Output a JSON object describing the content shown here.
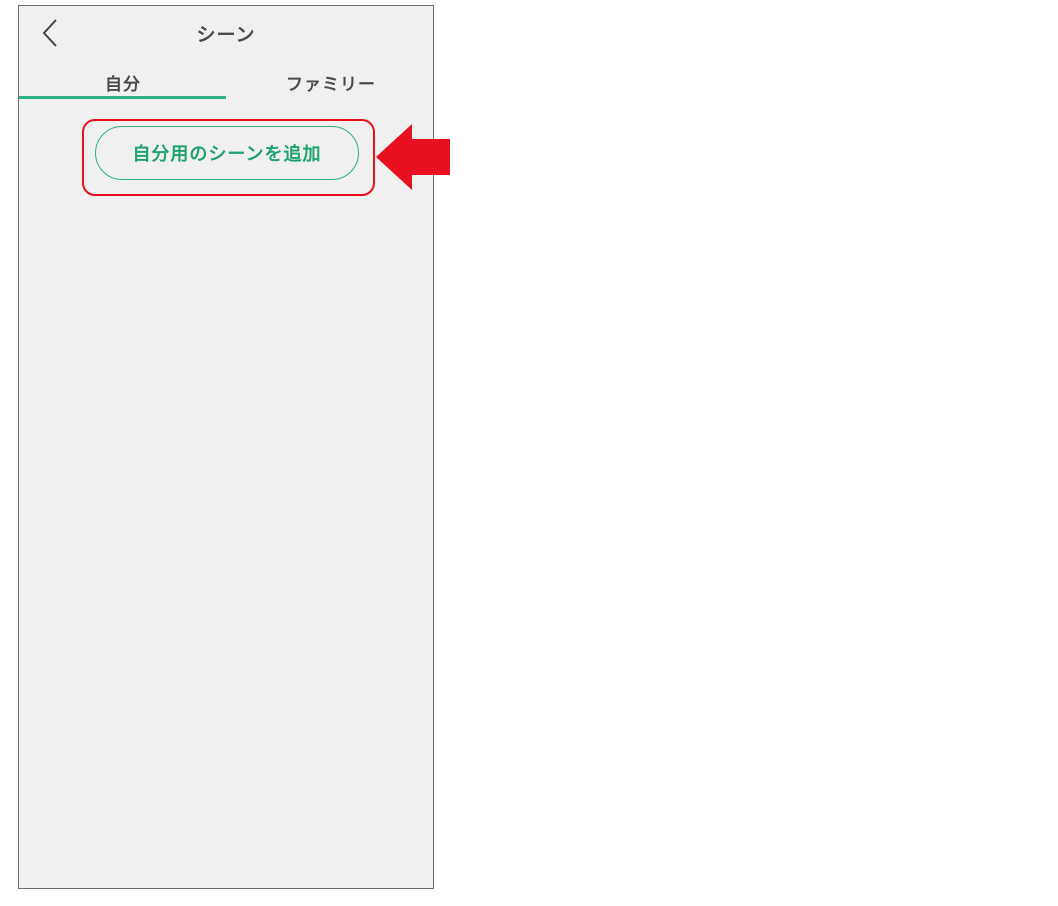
{
  "header": {
    "title": "シーン",
    "back_icon": "chevron-left-icon"
  },
  "tabs": [
    {
      "label": "自分",
      "selected": true
    },
    {
      "label": "ファミリー",
      "selected": false
    }
  ],
  "actions": {
    "add_scene_label": "自分用のシーンを追加"
  },
  "annotation": {
    "highlight_color": "#e8101e",
    "arrow_icon": "arrow-left-icon",
    "arrow_color": "#e8101e"
  },
  "colors": {
    "accent": "#2eb281",
    "accent_text": "#1fa270",
    "screen_background": "#f0f0f0"
  }
}
